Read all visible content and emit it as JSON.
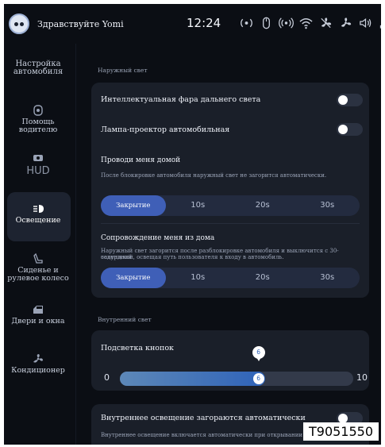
{
  "status_bar": {
    "greeting": "Здравствуйте Yomi",
    "time": "12:24",
    "icons": [
      "radio-signal-icon",
      "mouse-icon",
      "wireless-icon",
      "wifi-icon",
      "fan-icon",
      "climate-icon",
      "volume-icon",
      "signal-bars-icon"
    ]
  },
  "sidebar": {
    "items": [
      {
        "label": "Настройка автомобиля",
        "icon": null,
        "active": false
      },
      {
        "label": "Помощь водителю",
        "icon": "steering-wheel-icon",
        "active": false
      },
      {
        "label": "HUD",
        "icon": "hud-icon",
        "active": false
      },
      {
        "label": "Освещение",
        "icon": "headlight-icon",
        "active": true
      },
      {
        "label": "Сиденье и рулевое колесо",
        "icon": "seat-icon",
        "active": false
      },
      {
        "label": "Двери и окна",
        "icon": "door-icon",
        "active": false
      },
      {
        "label": "Кондиционер",
        "icon": "fan-icon",
        "active": false
      }
    ]
  },
  "main": {
    "exterior_section": "Наружный свет",
    "intelligent_beam": {
      "label": "Интеллектуальная фара дальнего света",
      "on": false
    },
    "projector_lamp": {
      "label": "Лампа-проектор автомобильная",
      "on": false
    },
    "follow_me_home": {
      "title": "Проводи меня домой",
      "description": "После блокировке автомобиля наружный свет не загорится автоматически.",
      "options": [
        "Закрытие",
        "10s",
        "20s",
        "30s"
      ],
      "selected": "Закрытие"
    },
    "escort_from_home": {
      "title": "Сопровождение меня из дома",
      "description_line1": "Наружный свет загорится после разблокировке автомобиля и выключится с 30-секундной",
      "description_line2": "задержкой, освещая путь пользователя к входу в автомобиль.",
      "options": [
        "Закрытие",
        "10s",
        "20s",
        "30s"
      ],
      "selected": "Закрытие"
    },
    "interior_section": "Внутренний свет",
    "button_backlight": {
      "label": "Подсветка кнопок",
      "min": "0",
      "max": "10",
      "value": 6,
      "value_text": "6"
    },
    "auto_interior": {
      "label": "Внутреннее освещение загораются автоматически",
      "description": "Внутреннее освещение включается автоматически при открывании двери",
      "on": false
    }
  },
  "watermark": "T9051550",
  "colors": {
    "background": "#0b0e14",
    "card": "#1a1f29",
    "accent": "#3f5fb7",
    "active_item": "#1d2330"
  }
}
